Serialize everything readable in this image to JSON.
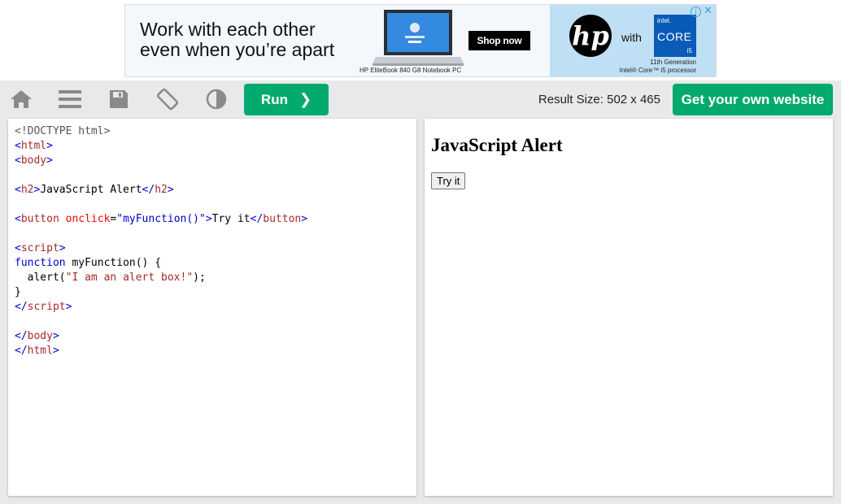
{
  "ad": {
    "headline_line1": "Work with each other",
    "headline_line2": "even when you’re apart",
    "product_caption": "HP EliteBook 840 G8 Notebook PC",
    "shop_label": "Shop now",
    "hp_logo_text": "hp",
    "with_label": "with",
    "intel_top": "intel.",
    "intel_core": "CORE",
    "intel_tier": "i5",
    "intel_caption_line1": "11th Generation",
    "intel_caption_line2": "Intel® Core™ i5 processor",
    "info_symbol": "i",
    "close_symbol": "✕"
  },
  "toolbar": {
    "icons": [
      "home-icon",
      "menu-icon",
      "save-icon",
      "rotate-icon",
      "contrast-icon"
    ],
    "run_label": "Run",
    "run_chevron": "❯",
    "result_size": "Result Size: 502 x 465",
    "get_website_label": "Get your own website"
  },
  "result": {
    "heading": "JavaScript Alert",
    "button_label": "Try it"
  },
  "colors": {
    "accent_green": "#04aa6d",
    "toolbar_bg": "#e7e9eb"
  }
}
